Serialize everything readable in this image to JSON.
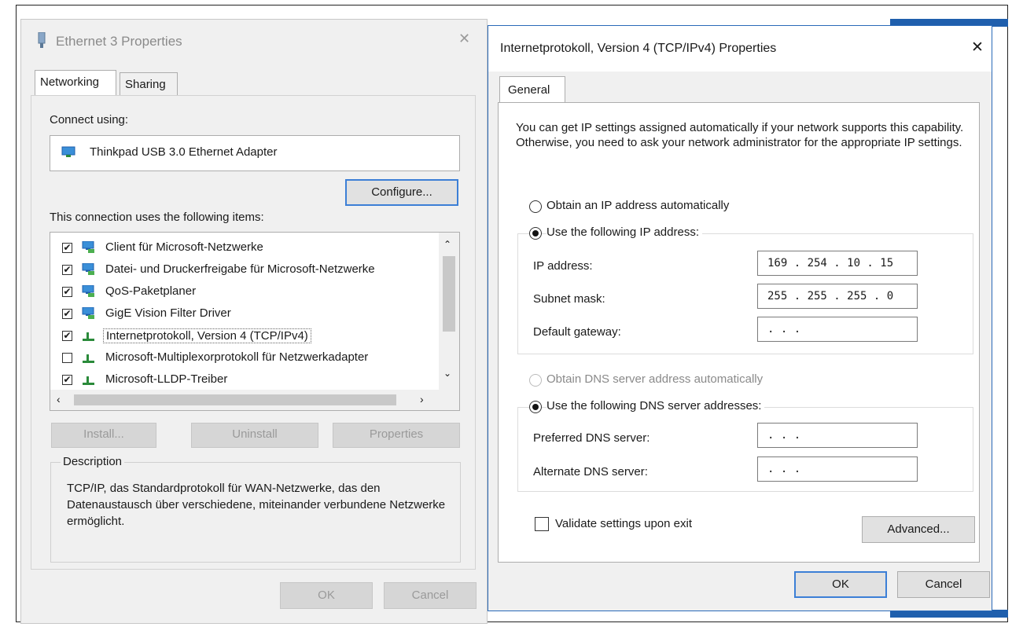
{
  "left_window": {
    "title": "Ethernet 3 Properties",
    "close": "✕",
    "tabs": [
      "Networking",
      "Sharing"
    ],
    "connect_using_label": "Connect using:",
    "adapter_name": "Thinkpad USB 3.0 Ethernet Adapter",
    "configure_button": "Configure...",
    "items_label": "This connection uses the following items:",
    "items": [
      {
        "label": "Client für Microsoft-Netzwerke",
        "checked": true,
        "icon": "network-client-icon"
      },
      {
        "label": "Datei- und Druckerfreigabe für Microsoft-Netzwerke",
        "checked": true,
        "icon": "network-service-icon"
      },
      {
        "label": "QoS-Paketplaner",
        "checked": true,
        "icon": "network-service-icon"
      },
      {
        "label": "GigE Vision Filter Driver",
        "checked": true,
        "icon": "network-service-icon"
      },
      {
        "label": "Internetprotokoll, Version 4 (TCP/IPv4)",
        "checked": true,
        "icon": "network-protocol-icon",
        "selected": true
      },
      {
        "label": "Microsoft-Multiplexorprotokoll für Netzwerkadapter",
        "checked": false,
        "icon": "network-protocol-icon"
      },
      {
        "label": "Microsoft-LLDP-Treiber",
        "checked": true,
        "icon": "network-protocol-icon"
      }
    ],
    "install_button": "Install...",
    "uninstall_button": "Uninstall",
    "properties_button": "Properties",
    "description_label": "Description",
    "description_text": "TCP/IP, das Standardprotokoll für WAN-Netzwerke, das den Datenaustausch über verschiedene, miteinander verbundene Netzwerke ermöglicht.",
    "ok_button": "OK",
    "cancel_button": "Cancel"
  },
  "right_window": {
    "title": "Internetprotokoll, Version 4 (TCP/IPv4) Properties",
    "close": "✕",
    "tab": "General",
    "intro": "You can get IP settings assigned automatically if your network supports this capability. Otherwise, you need to ask your network administrator for the appropriate IP settings.",
    "obtain_ip_auto": "Obtain an IP address automatically",
    "use_following_ip": "Use the following IP address:",
    "ip_address_label": "IP address:",
    "ip_address_value": "169 . 254 .  10 .  15",
    "subnet_label": "Subnet mask:",
    "subnet_value": "255 . 255 . 255 .  0",
    "gateway_label": "Default gateway:",
    "gateway_value": "     .     .     .",
    "obtain_dns_auto": "Obtain DNS server address automatically",
    "use_following_dns": "Use the following DNS server addresses:",
    "preferred_dns_label": "Preferred DNS server:",
    "preferred_dns_value": "     .     .     .",
    "alternate_dns_label": "Alternate DNS server:",
    "alternate_dns_value": "     .     .     .",
    "validate_label": "Validate settings upon exit",
    "advanced_button": "Advanced...",
    "ok_button": "OK",
    "cancel_button": "Cancel"
  },
  "colors": {
    "accent": "#3c7fd6",
    "taskbar_blue": "#1f5fad",
    "window_bg": "#f0f0f0"
  }
}
